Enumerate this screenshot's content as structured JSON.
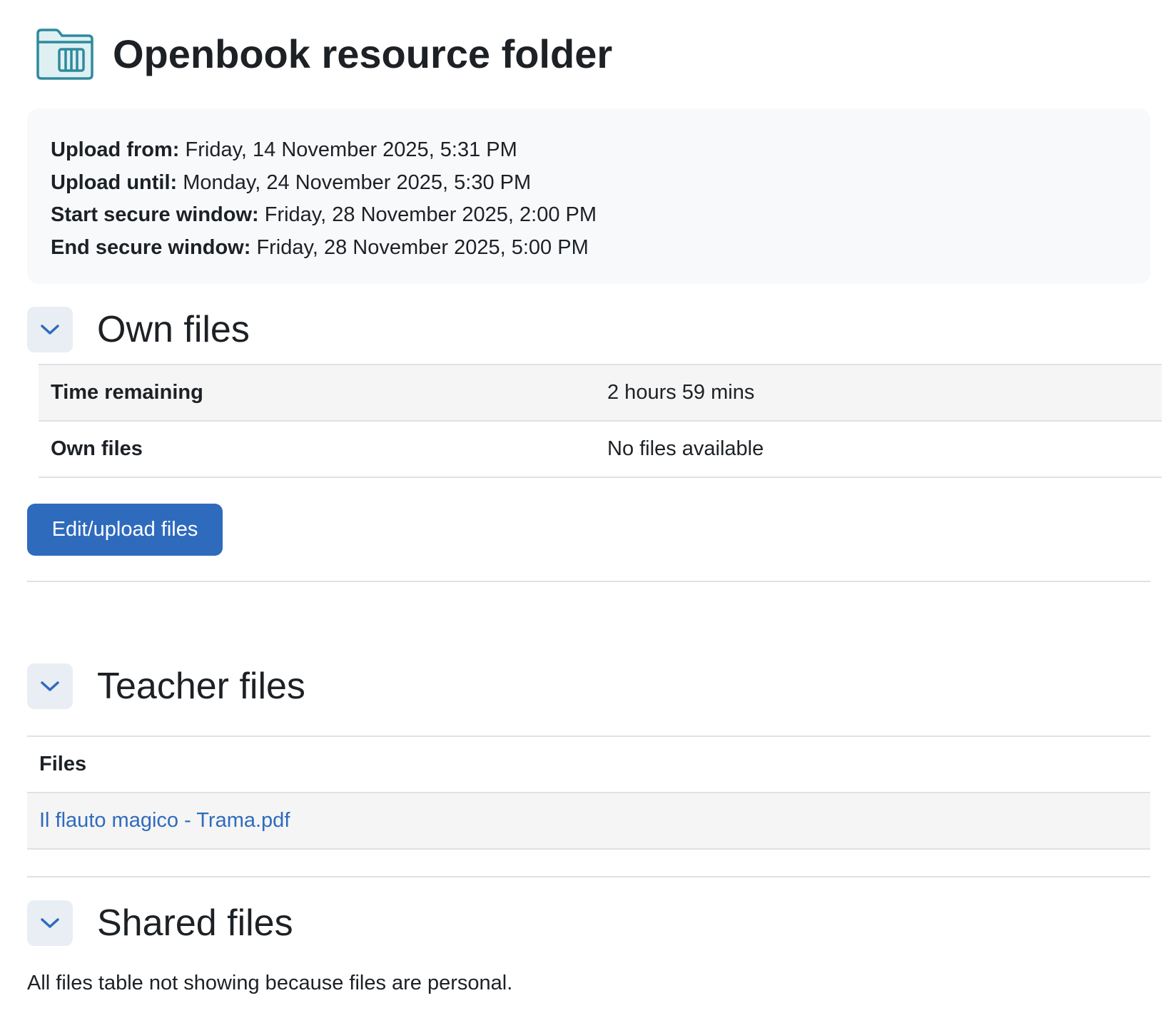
{
  "header": {
    "title": "Openbook resource folder",
    "icon": "folder-book-icon",
    "icon_color": "#2e8a9e"
  },
  "dates": {
    "upload_from": {
      "label": "Upload from:",
      "value": "Friday, 14 November 2025, 5:31 PM"
    },
    "upload_until": {
      "label": "Upload until:",
      "value": "Monday, 24 November 2025, 5:30 PM"
    },
    "start_secure": {
      "label": "Start secure window:",
      "value": "Friday, 28 November 2025, 2:00 PM"
    },
    "end_secure": {
      "label": "End secure window:",
      "value": "Friday, 28 November 2025, 5:00 PM"
    }
  },
  "own_files": {
    "title": "Own files",
    "rows": [
      {
        "label": "Time remaining",
        "value": "2 hours 59 mins"
      },
      {
        "label": "Own files",
        "value": "No files available"
      }
    ],
    "button_label": "Edit/upload files"
  },
  "teacher_files": {
    "title": "Teacher files",
    "column_header": "Files",
    "files": [
      {
        "name": "Il flauto magico - Trama.pdf"
      }
    ]
  },
  "shared_files": {
    "title": "Shared files",
    "note": "All files table not showing because files are personal."
  },
  "colors": {
    "accent": "#2f6bbd",
    "toggle_bg": "#e9eef5",
    "panel_bg": "#f8f9fa"
  }
}
